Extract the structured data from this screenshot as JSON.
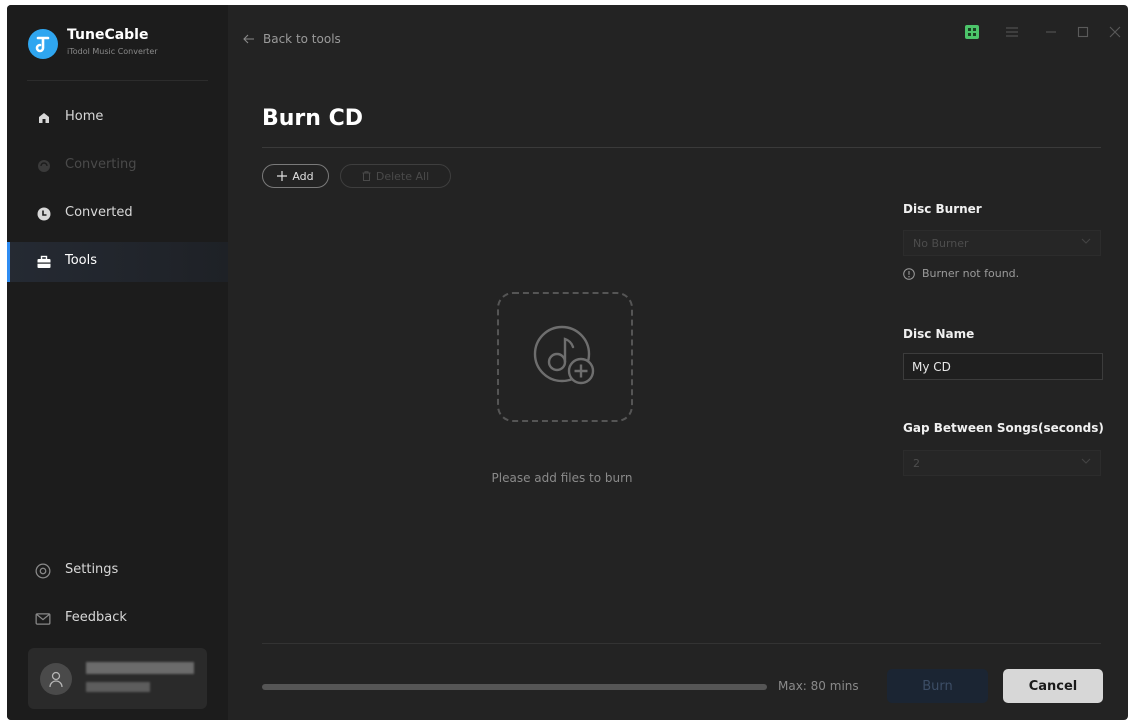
{
  "app": {
    "name": "TuneCable",
    "subtitle": "iTodol Music Converter"
  },
  "sidebar": {
    "items": [
      {
        "label": "Home",
        "icon": "home-icon"
      },
      {
        "label": "Converting",
        "icon": "sync-icon",
        "state": "disabled"
      },
      {
        "label": "Converted",
        "icon": "clock-icon"
      },
      {
        "label": "Tools",
        "icon": "toolbox-icon",
        "state": "active"
      }
    ],
    "settings_label": "Settings",
    "feedback_label": "Feedback"
  },
  "header": {
    "back_label": "Back to tools"
  },
  "page": {
    "title": "Burn CD",
    "add_label": "Add",
    "delete_all_label": "Delete All",
    "empty_hint": "Please add files to burn"
  },
  "settings": {
    "disc_burner_label": "Disc Burner",
    "disc_burner_value": "No Burner",
    "burner_warning": "Burner not found.",
    "disc_name_label": "Disc Name",
    "disc_name_value": "My CD",
    "gap_label": "Gap Between Songs(seconds)",
    "gap_value": "2"
  },
  "footer": {
    "max_label": "Max: 80 mins",
    "burn_label": "Burn",
    "cancel_label": "Cancel"
  },
  "colors": {
    "accent": "#2e8cf2",
    "background": "#232323",
    "sidebar": "#1c1c1c",
    "grid_icon": "#4cc46a"
  }
}
